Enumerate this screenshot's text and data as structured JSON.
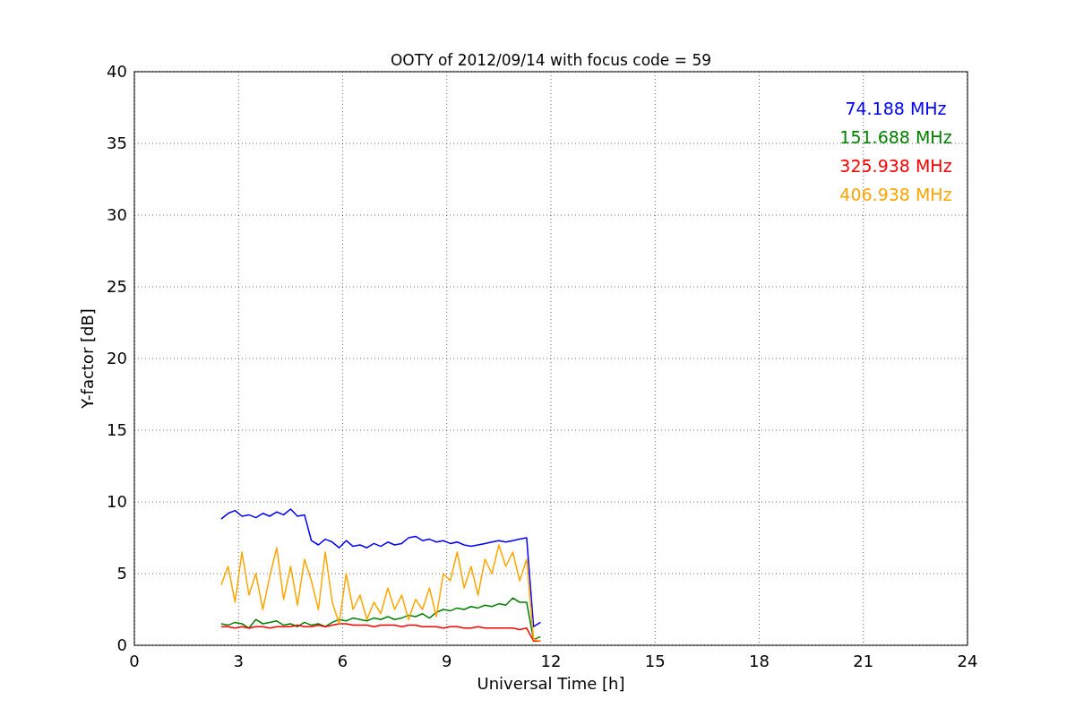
{
  "chart_data": {
    "type": "line",
    "title": "OOTY of 2012/09/14 with focus code = 59",
    "xlabel": "Universal Time [h]",
    "ylabel": "Y-factor [dB]",
    "x": [
      2.5,
      2.7,
      2.9,
      3.1,
      3.3,
      3.5,
      3.7,
      3.9,
      4.1,
      4.3,
      4.5,
      4.7,
      4.9,
      5.1,
      5.3,
      5.5,
      5.7,
      5.9,
      6.1,
      6.3,
      6.5,
      6.7,
      6.9,
      7.1,
      7.3,
      7.5,
      7.7,
      7.9,
      8.1,
      8.3,
      8.5,
      8.7,
      8.9,
      9.1,
      9.3,
      9.5,
      9.7,
      9.9,
      10.1,
      10.3,
      10.5,
      10.7,
      10.9,
      11.1,
      11.3,
      11.5,
      11.7
    ],
    "series": [
      {
        "name": "74.188 MHz",
        "color": "#0000ff",
        "values": [
          8.8,
          9.2,
          9.4,
          9.0,
          9.1,
          8.9,
          9.2,
          9.0,
          9.3,
          9.1,
          9.5,
          9.0,
          9.1,
          7.3,
          7.0,
          7.4,
          7.2,
          6.8,
          7.3,
          6.9,
          7.0,
          6.8,
          7.1,
          6.9,
          7.2,
          7.0,
          7.1,
          7.5,
          7.6,
          7.3,
          7.4,
          7.2,
          7.3,
          7.1,
          7.2,
          7.0,
          6.9,
          7.0,
          7.1,
          7.2,
          7.3,
          7.2,
          7.3,
          7.4,
          7.5,
          1.3,
          1.6
        ]
      },
      {
        "name": "151.688 MHz",
        "color": "#008000",
        "values": [
          1.5,
          1.4,
          1.6,
          1.5,
          1.2,
          1.8,
          1.5,
          1.6,
          1.7,
          1.4,
          1.5,
          1.3,
          1.6,
          1.4,
          1.5,
          1.3,
          1.6,
          1.8,
          1.7,
          1.9,
          1.8,
          1.7,
          1.9,
          1.8,
          2.0,
          1.8,
          1.9,
          2.1,
          2.0,
          2.2,
          1.9,
          2.3,
          2.5,
          2.4,
          2.6,
          2.5,
          2.7,
          2.6,
          2.8,
          2.7,
          2.9,
          2.8,
          3.3,
          3.0,
          3.0,
          0.4,
          0.6
        ]
      },
      {
        "name": "325.938 MHz",
        "color": "#ff0000",
        "values": [
          1.3,
          1.3,
          1.2,
          1.3,
          1.2,
          1.3,
          1.3,
          1.2,
          1.3,
          1.3,
          1.3,
          1.4,
          1.3,
          1.3,
          1.4,
          1.3,
          1.4,
          1.5,
          1.5,
          1.4,
          1.4,
          1.4,
          1.3,
          1.4,
          1.4,
          1.4,
          1.3,
          1.4,
          1.4,
          1.3,
          1.3,
          1.3,
          1.2,
          1.3,
          1.3,
          1.2,
          1.2,
          1.3,
          1.2,
          1.2,
          1.2,
          1.2,
          1.2,
          1.1,
          1.2,
          0.3,
          0.3
        ]
      },
      {
        "name": "406.938 MHz",
        "color": "#ffa500",
        "values": [
          4.2,
          5.5,
          3.0,
          6.5,
          3.5,
          5.0,
          2.5,
          4.8,
          6.8,
          3.2,
          5.5,
          2.8,
          6.0,
          4.5,
          2.5,
          6.5,
          3.0,
          1.5,
          5.0,
          2.5,
          3.5,
          1.8,
          3.0,
          2.2,
          4.0,
          2.5,
          3.5,
          1.8,
          3.2,
          2.5,
          4.0,
          2.0,
          5.0,
          4.5,
          6.5,
          4.0,
          5.5,
          3.5,
          6.0,
          5.0,
          7.0,
          5.5,
          6.5,
          4.5,
          6.0,
          0.4,
          0.3
        ]
      }
    ],
    "xlim": [
      0,
      24
    ],
    "ylim": [
      0,
      40
    ],
    "grid": true,
    "xticks": [
      0,
      3,
      6,
      9,
      12,
      15,
      18,
      21,
      24
    ],
    "yticks": [
      0,
      5,
      10,
      15,
      20,
      25,
      30,
      35,
      40
    ]
  }
}
